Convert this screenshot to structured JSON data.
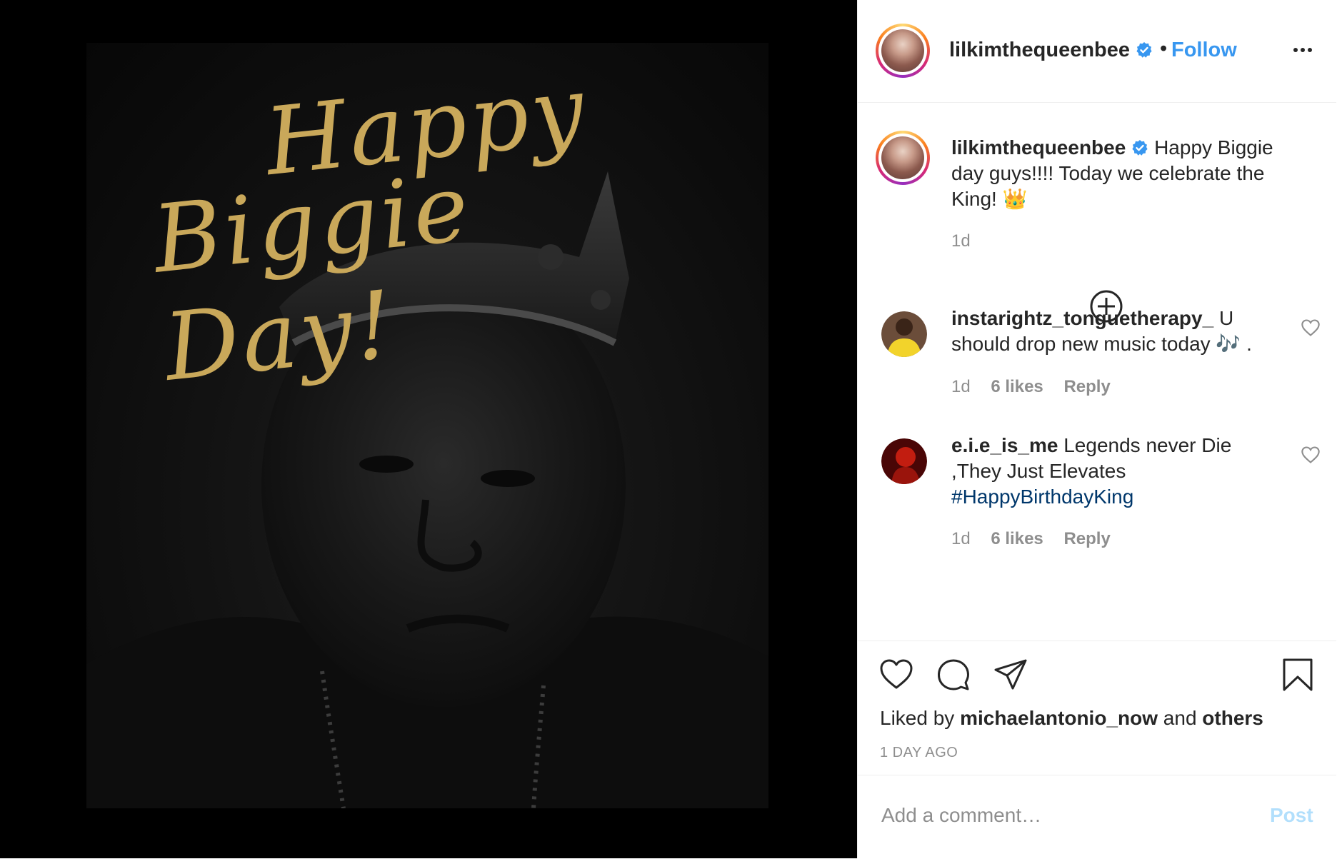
{
  "media": {
    "image_alt": "Portrait with crown",
    "overlay_line1": "Happy",
    "overlay_line2": "Biggie Day!"
  },
  "header": {
    "username": "lilkimthequeenbee",
    "separator": "•",
    "follow_label": "Follow"
  },
  "caption": {
    "username": "lilkimthequeenbee",
    "text": "Happy Biggie day guys!!!! Today we celebrate the King! 👑",
    "time": "1d"
  },
  "comments": [
    {
      "username": "instarightz_tonguetherapy_",
      "text": "U should drop new music today 🎶 .",
      "time": "1d",
      "likes": "6 likes",
      "reply": "Reply"
    },
    {
      "username": "e.i.e_is_me",
      "text": "Legends never Die ,They Just Elevates",
      "hashtag": "#HappyBirthdayKing",
      "time": "1d",
      "likes": "6 likes",
      "reply": "Reply"
    }
  ],
  "actions": {
    "liked_by_prefix": "Liked by",
    "liked_by_user": "michaelantonio_now",
    "liked_by_joiner": "and",
    "liked_by_others": "others",
    "post_age": "1 DAY AGO"
  },
  "comment_box": {
    "placeholder": "Add a comment…",
    "post_label": "Post"
  },
  "colors": {
    "accent": "#3897f0",
    "verified": "#3897f0",
    "hashtag": "#00376b",
    "muted": "#8e8e8e",
    "post_disabled": "#b2dffc",
    "script_gold": "#c9a85a"
  },
  "icons": [
    "verified-badge-icon",
    "more-options-icon",
    "add-circle-icon",
    "heart-icon",
    "comment-icon",
    "share-icon",
    "bookmark-icon"
  ]
}
